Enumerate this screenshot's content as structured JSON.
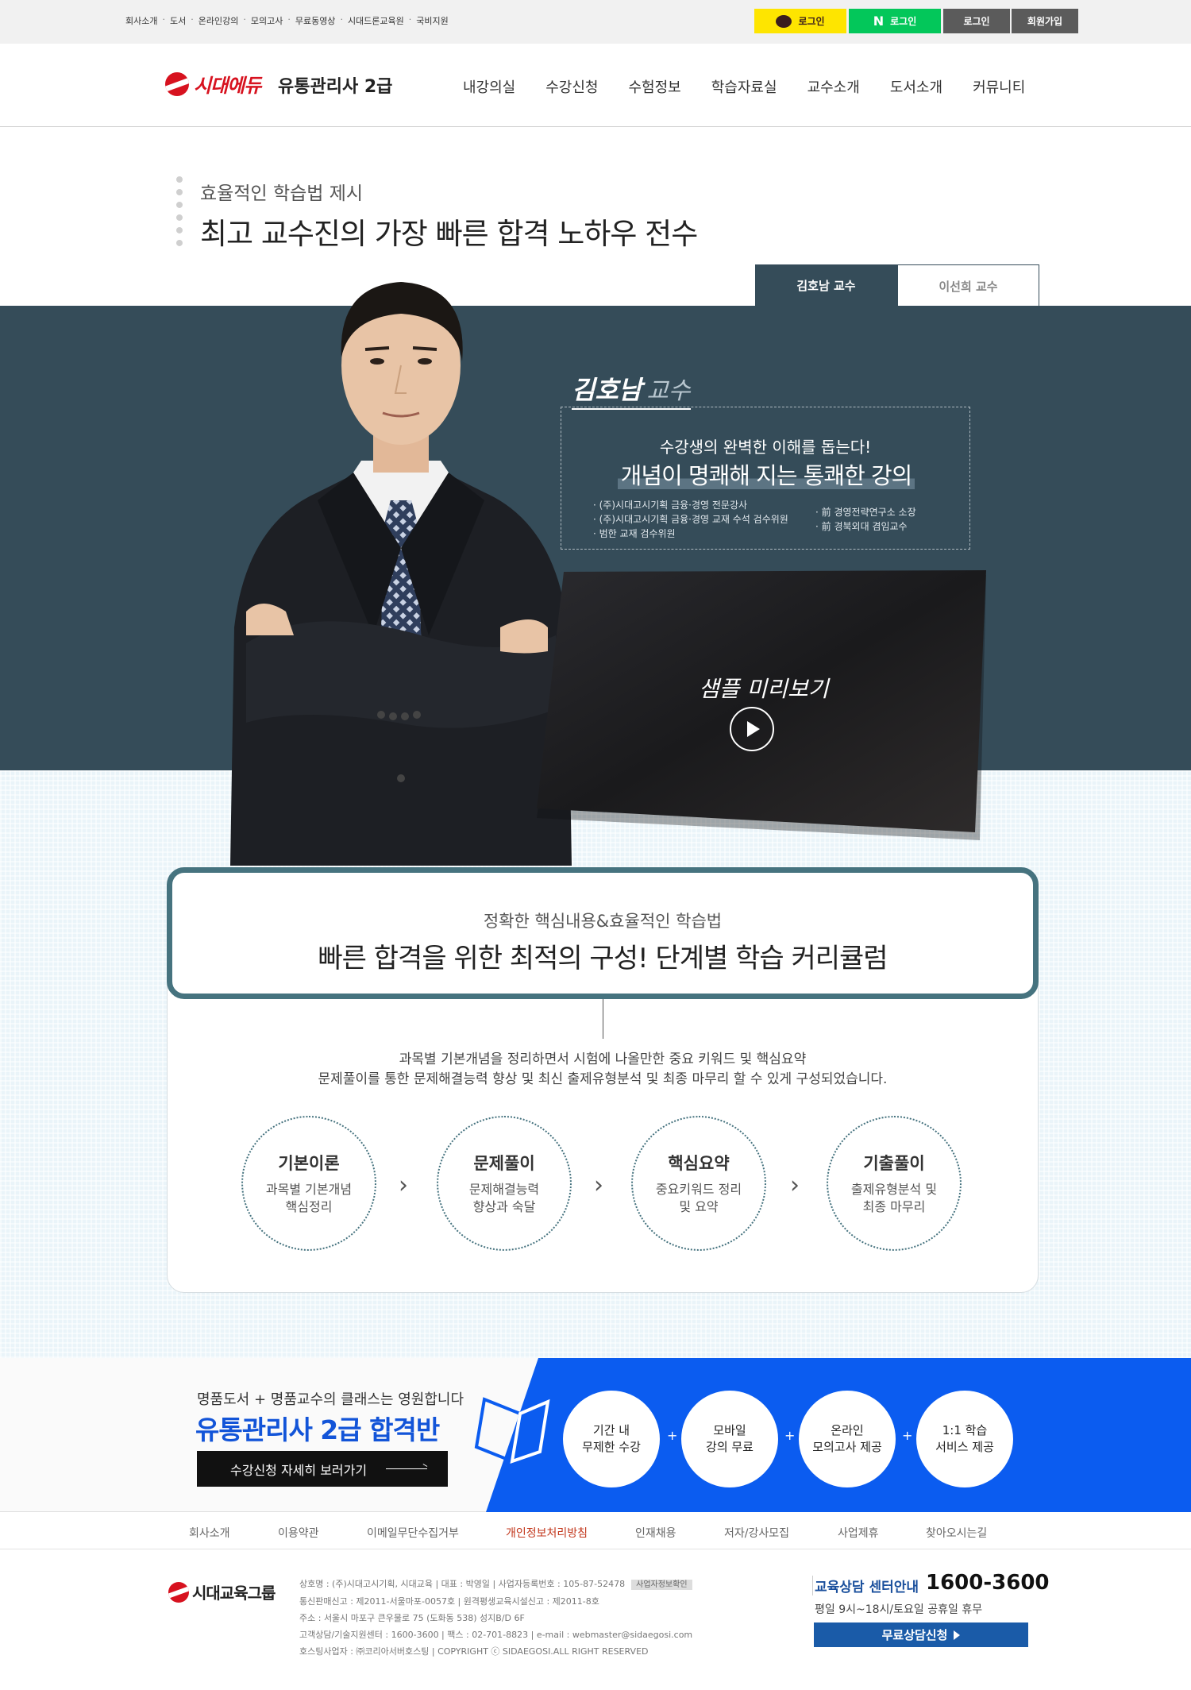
{
  "topbar": {
    "links": [
      "회사소개",
      "도서",
      "온라인강의",
      "모의고사",
      "무료동영상",
      "시대드론교육원",
      "국비지원"
    ],
    "kakao_login": "로그인",
    "naver_login": "로그인",
    "login": "로그인",
    "join": "회원가입"
  },
  "header": {
    "logo": "시대에듀",
    "site_title": "유통관리사 2급",
    "nav": [
      "내강의실",
      "수강신청",
      "수험정보",
      "학습자료실",
      "교수소개",
      "도서소개",
      "커뮤니티"
    ]
  },
  "intro": {
    "subtitle": "효율적인 학습법 제시",
    "title": "최고 교수진의 가장 빠른 합격 노하우 전수"
  },
  "tabs": [
    "김호남 교수",
    "이선희 교수"
  ],
  "professor": {
    "name": "김호남",
    "suffix": "교수",
    "tagline": "수강생의 완벽한 이해를 돕는다!",
    "headline": "개념이 명쾌해 지는 통쾌한 강의",
    "credentials_left": [
      "· (주)시대고시기획 금융·경영 전문강사",
      "· (주)시대고시기획 금융·경영 교재 수석 검수위원",
      "· 범한 교재 검수위원"
    ],
    "credentials_right": [
      "· 前 경영전략연구소 소장",
      "· 前 경북외대 겸임교수"
    ],
    "video_label": "샘플 미리보기"
  },
  "curriculum": {
    "subtitle": "정확한 핵심내용&효율적인 학습법",
    "title": "빠른 합격을 위한 최적의 구성! 단계별 학습 커리큘럼",
    "desc_line1": "과목별 기본개념을 정리하면서 시험에 나올만한 중요 키워드 및 핵심요약",
    "desc_line2": "문제풀이를 통한 문제해결능력 향상 및 최신 출제유형분석 및 최종 마무리 할 수 있게 구성되었습니다.",
    "steps": [
      {
        "title": "기본이론",
        "line1": "과목별 기본개념",
        "line2": "핵심정리"
      },
      {
        "title": "문제풀이",
        "line1": "문제해결능력",
        "line2": "향상과 숙달"
      },
      {
        "title": "핵심요약",
        "line1": "중요키워드 정리",
        "line2": "및 요약"
      },
      {
        "title": "기출풀이",
        "line1": "출제유형분석 및",
        "line2": "최종 마무리"
      }
    ]
  },
  "banner": {
    "subtitle": "명품도서 + 명품교수의 클래스는 영원합니다",
    "title": "유통관리사 2급 합격반",
    "button": "수강신청 자세히 보러가기",
    "features": [
      {
        "line1": "기간 내",
        "line2": "무제한 수강"
      },
      {
        "line1": "모바일",
        "line2": "강의 무료"
      },
      {
        "line1": "온라인",
        "line2": "모의고사 제공"
      },
      {
        "line1": "1:1 학습",
        "line2": "서비스 제공"
      }
    ],
    "plus": "+",
    "colors": {
      "blue": "#0b5cf0"
    }
  },
  "footer_links": [
    "회사소개",
    "이용약관",
    "이메일무단수집거부",
    "개인정보처리방침",
    "인재채용",
    "저자/강사모집",
    "사업제휴",
    "찾아오시는길"
  ],
  "footer": {
    "logo": "시대교육그룹",
    "info": [
      "상호명 : (주)시대고시기획, 시대교육 | 대표 : 박영일 | 사업자등록번호 : 105-87-52478",
      "통신판매신고 : 제2011-서울마포-0057호 | 원격평생교육시설신고 : 제2011-8호",
      "주소 : 서울시 마포구 큰우물로 75 (도화동 538) 성지B/D 6F",
      "고객상담/기술지원센터 : 1600-3600 | 팩스 : 02-701-8823 | e-mail : webmaster@sidaegosi.com",
      "호스팅사업자 : ㈜코리아서버호스팅 | COPYRIGHT ⓒ SIDAEGOSI.ALL RIGHT RESERVED"
    ],
    "badge": "사업자정보확인",
    "cs_title": "교육상담 센터안내",
    "cs_number": "1600-3600",
    "cs_hours": "평일 9시~18시/토요일 공휴일 휴무",
    "cs_button": "무료상담신청"
  }
}
